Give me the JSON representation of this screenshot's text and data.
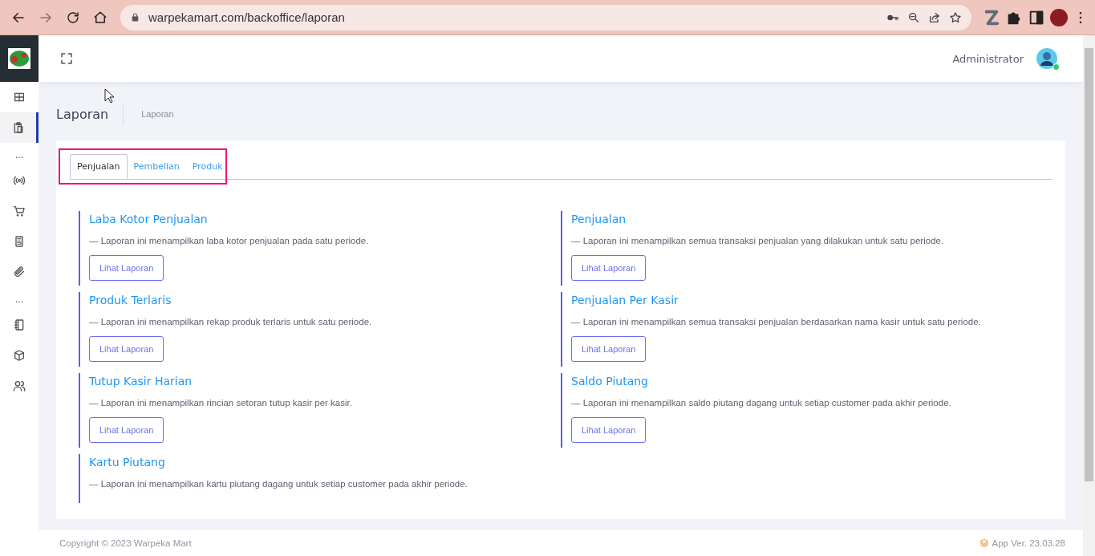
{
  "browser": {
    "url": "warpekamart.com/backoffice/laporan",
    "forward_disabled": true
  },
  "sidebar": {
    "items": [
      {
        "kind": "icon",
        "selected": false
      },
      {
        "kind": "icon",
        "selected": true
      },
      {
        "kind": "separator",
        "label": "..."
      },
      {
        "kind": "icon",
        "selected": false
      },
      {
        "kind": "icon",
        "selected": false
      },
      {
        "kind": "icon",
        "selected": false
      },
      {
        "kind": "icon",
        "selected": false
      },
      {
        "kind": "separator",
        "label": "..."
      },
      {
        "kind": "icon",
        "selected": false
      },
      {
        "kind": "icon",
        "selected": false
      },
      {
        "kind": "icon",
        "selected": false
      }
    ]
  },
  "header": {
    "user": "Administrator",
    "online": true
  },
  "page": {
    "title": "Laporan",
    "breadcrumb": "Laporan"
  },
  "tabs": [
    {
      "label": "Penjualan",
      "selected": true
    },
    {
      "label": "Pembelian",
      "selected": false
    },
    {
      "label": "Produk",
      "selected": false
    }
  ],
  "highlight": true,
  "reports": {
    "left": [
      {
        "title": "Laba Kotor Penjualan",
        "description": "— Laporan ini menampilkan laba kotor penjualan pada satu periode.",
        "button": "Lihat Laporan"
      },
      {
        "title": "Produk Terlaris",
        "description": "— Laporan ini menampilkan rekap produk terlaris untuk satu periode.",
        "button": "Lihat Laporan"
      },
      {
        "title": "Tutup Kasir Harian",
        "description": "— Laporan ini menampilkan rincian setoran tutup kasir per kasir.",
        "button": "Lihat Laporan"
      },
      {
        "title": "Kartu Piutang",
        "description": "— Laporan ini menampilkan kartu piutang dagang untuk setiap customer pada akhir periode."
      }
    ],
    "right": [
      {
        "title": "Penjualan",
        "description": "— Laporan ini menampilkan semua transaksi penjualan yang dilakukan untuk satu periode.",
        "button": "Lihat Laporan"
      },
      {
        "title": "Penjualan Per Kasir",
        "description": "— Laporan ini menampilkan semua transaksi penjualan berdasarkan nama kasir untuk satu periode.",
        "button": "Lihat Laporan"
      },
      {
        "title": "Saldo Piutang",
        "description": "— Laporan ini menampilkan saldo piutang dagang untuk setiap customer pada akhir periode.",
        "button": "Lihat Laporan"
      }
    ]
  },
  "footer": {
    "copyright": "Copyright © 2023 Warpeka Mart",
    "version": "App Ver. 23.03.28"
  }
}
